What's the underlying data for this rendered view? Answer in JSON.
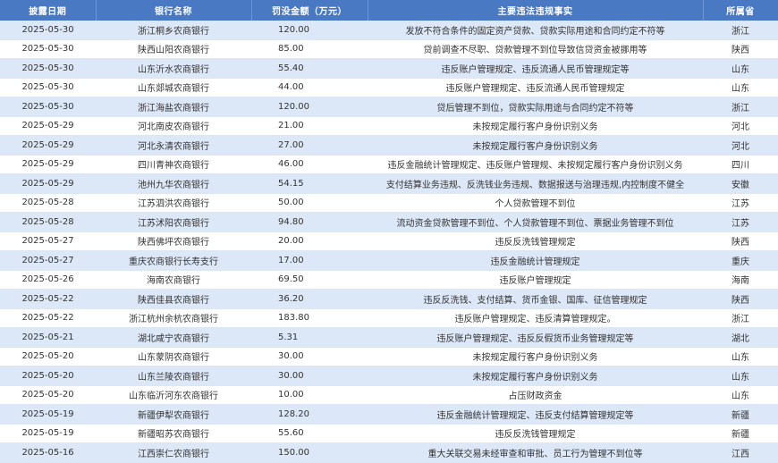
{
  "table": {
    "headers": [
      "披露日期",
      "银行名称",
      "罚没金额（万元）",
      "主要违法违规事实",
      "所属省"
    ],
    "rows": [
      [
        "2025-05-30",
        "浙江桐乡农商银行",
        "120.00",
        "发放不符合条件的固定资产贷款、贷款实际用途和合同约定不符等",
        "浙江"
      ],
      [
        "2025-05-30",
        "陕西山阳农商银行",
        "85.00",
        "贷前调查不尽职、贷款管理不到位导致信贷资金被挪用等",
        "陕西"
      ],
      [
        "2025-05-30",
        "山东沂水农商银行",
        "55.40",
        "违反账户管理规定、违反流通人民币管理规定等",
        "山东"
      ],
      [
        "2025-05-30",
        "山东郯城农商银行",
        "44.00",
        "违反账户管理规定、违反流通人民币管理规定",
        "山东"
      ],
      [
        "2025-05-30",
        "浙江海盐农商银行",
        "120.00",
        "贷后管理不到位，贷款实际用途与合同约定不符等",
        "浙江"
      ],
      [
        "2025-05-29",
        "河北南皮农商银行",
        "21.00",
        "未按规定履行客户身份识别义务",
        "河北"
      ],
      [
        "2025-05-29",
        "河北永清农商银行",
        "27.00",
        "未按规定履行客户身份识别义务",
        "河北"
      ],
      [
        "2025-05-29",
        "四川青神农商银行",
        "46.00",
        "违反金融统计管理规定、违反账户管理规、未按规定履行客户身份识别义务",
        "四川"
      ],
      [
        "2025-05-29",
        "池州九华农商银行",
        "54.15",
        "支付结算业务违规、反洗钱业务违规、数据报送与治理违规,内控制度不健全",
        "安徽"
      ],
      [
        "2025-05-28",
        "江苏泗洪农商银行",
        "50.00",
        "个人贷款管理不到位",
        "江苏"
      ],
      [
        "2025-05-28",
        "江苏沭阳农商银行",
        "94.80",
        "流动资金贷款管理不到位、个人贷款管理不到位、票据业务管理不到位",
        "江苏"
      ],
      [
        "2025-05-27",
        "陕西佛坪农商银行",
        "20.00",
        "违反反洗钱管理规定",
        "陕西"
      ],
      [
        "2025-05-27",
        "重庆农商银行长寿支行",
        "17.00",
        "违反金融统计管理规定",
        "重庆"
      ],
      [
        "2025-05-26",
        "海南农商银行",
        "69.50",
        "违反账户管理规定",
        "海南"
      ],
      [
        "2025-05-22",
        "陕西佳县农商银行",
        "36.20",
        "违反反洗钱、支付结算、货币金银、国库、征信管理规定",
        "陕西"
      ],
      [
        "2025-05-22",
        "浙江杭州余杭农商银行",
        "183.80",
        "违反账户管理规定、违反清算管理规定。",
        "浙江"
      ],
      [
        "2025-05-21",
        "湖北咸宁农商银行",
        "5.31",
        "违反账户管理规定、违反反假货币业务管理规定等",
        "湖北"
      ],
      [
        "2025-05-20",
        "山东蒙阴农商银行",
        "30.00",
        "未按规定履行客户身份识别义务",
        "山东"
      ],
      [
        "2025-05-20",
        "山东兰陵农商银行",
        "30.00",
        "未按规定履行客户身份识别义务",
        "山东"
      ],
      [
        "2025-05-20",
        "山东临沂河东农商银行",
        "10.00",
        "占压财政资金",
        "山东"
      ],
      [
        "2025-05-19",
        "新疆伊犁农商银行",
        "128.20",
        "违反金融统计管理规定、违反支付结算管理规定等",
        "新疆"
      ],
      [
        "2025-05-19",
        "新疆昭苏农商银行",
        "55.60",
        "违反反洗钱管理规定",
        "新疆"
      ],
      [
        "2025-05-16",
        "江西崇仁农商银行",
        "150.00",
        "重大关联交易未经审查和审批、员工行为管理不到位等",
        "江西"
      ]
    ]
  }
}
